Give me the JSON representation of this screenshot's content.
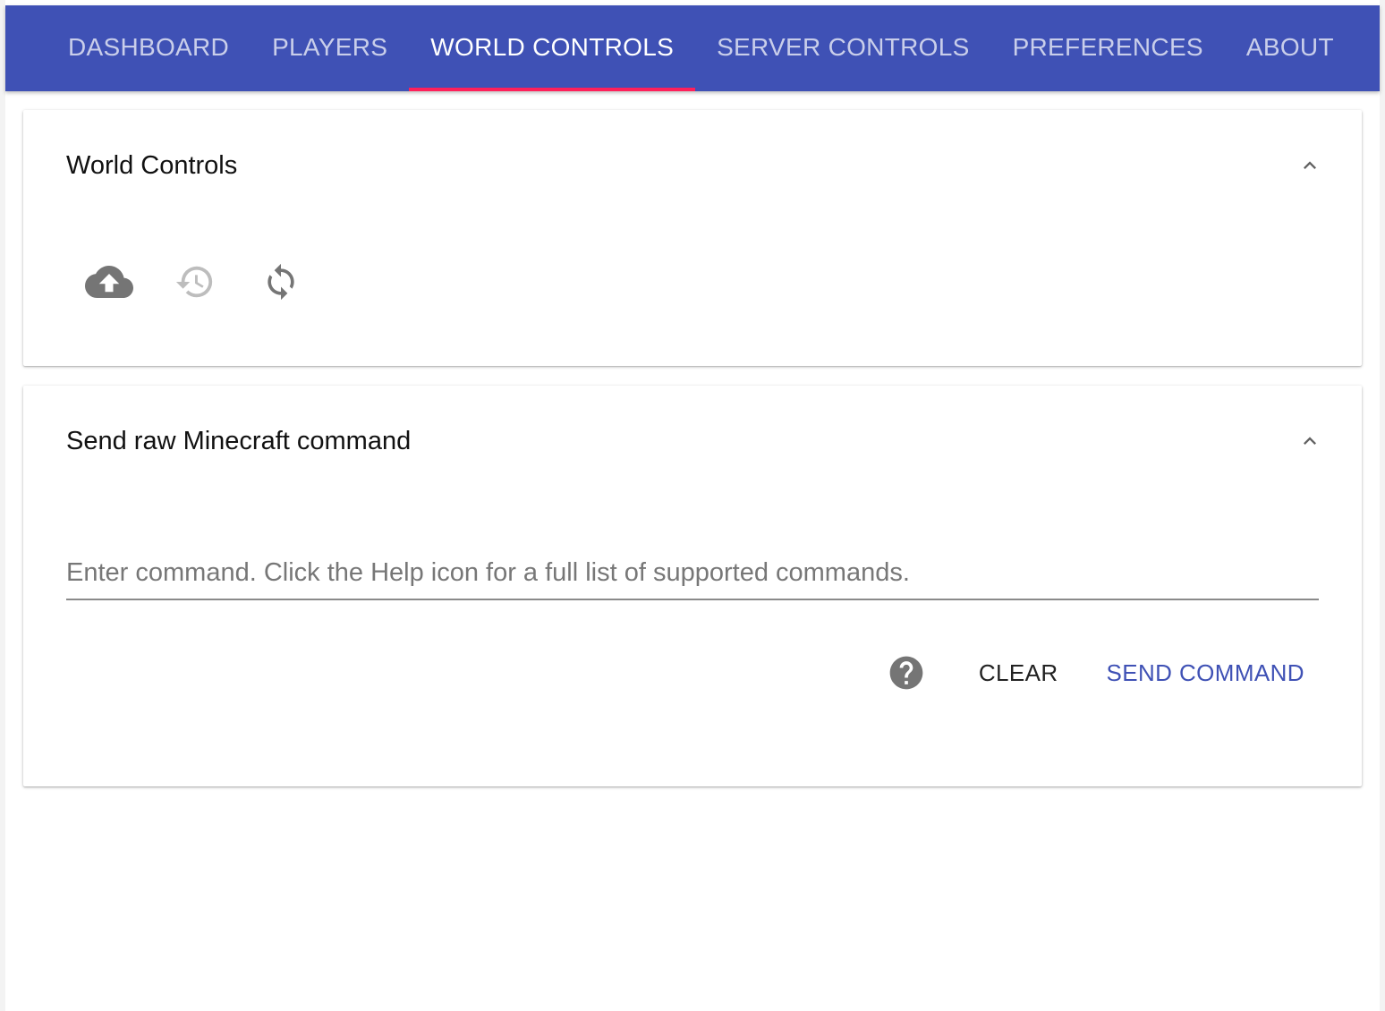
{
  "tabs": [
    {
      "label": "DASHBOARD",
      "active": false
    },
    {
      "label": "PLAYERS",
      "active": false
    },
    {
      "label": "WORLD CONTROLS",
      "active": true
    },
    {
      "label": "SERVER CONTROLS",
      "active": false
    },
    {
      "label": "PREFERENCES",
      "active": false
    },
    {
      "label": "ABOUT",
      "active": false
    }
  ],
  "world_controls": {
    "title": "World Controls",
    "collapse_icon": "chevron-up-icon",
    "actions": [
      {
        "icon": "cloud-upload-icon",
        "enabled": true
      },
      {
        "icon": "history-icon",
        "enabled": false
      },
      {
        "icon": "refresh-icon",
        "enabled": true
      }
    ]
  },
  "command": {
    "title": "Send raw Minecraft command",
    "collapse_icon": "chevron-up-icon",
    "input_value": "",
    "input_placeholder": "Enter command. Click the Help icon for a full list of supported commands.",
    "help_icon": "help-circle-icon",
    "clear_label": "CLEAR",
    "send_label": "SEND COMMAND"
  },
  "colors": {
    "primary": "#3f51b5",
    "tab_indicator": "#ff1f5a",
    "icon_active": "#757575",
    "icon_disabled": "#bdbdbd"
  }
}
